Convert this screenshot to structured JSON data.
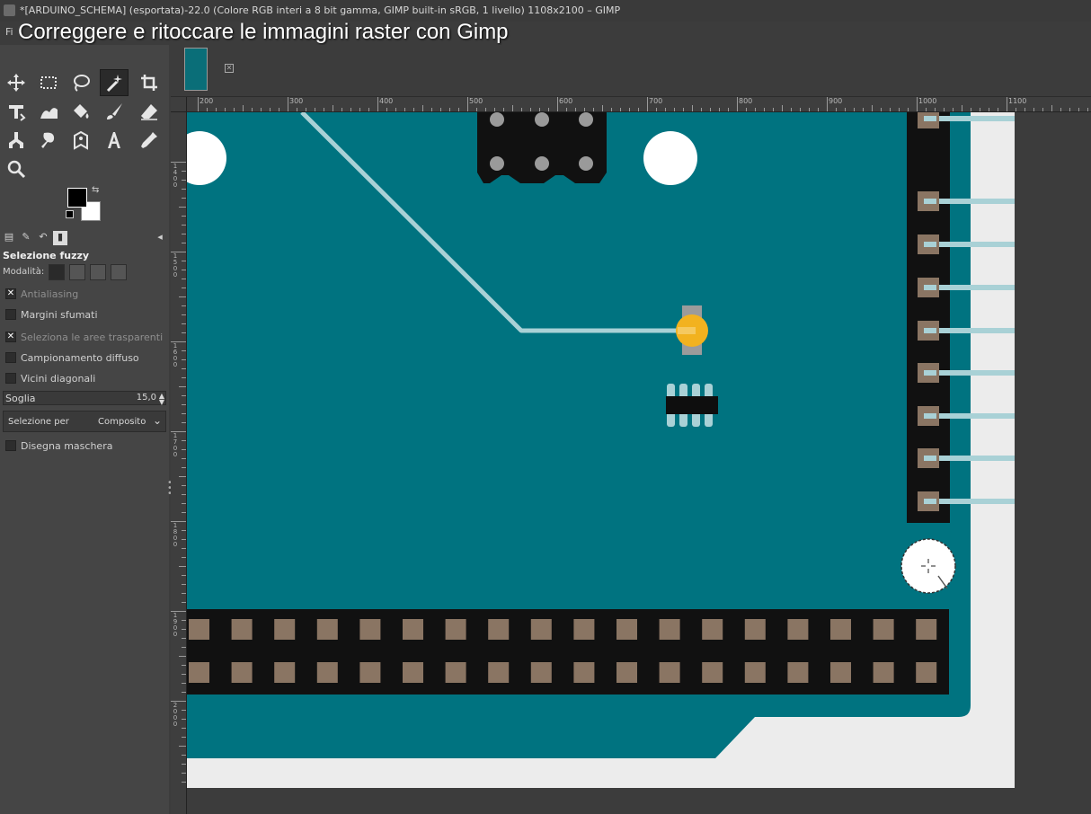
{
  "window": {
    "title": "*[ARDUINO_SCHEMA] (esportata)-22.0 (Colore RGB interi a 8 bit gamma, GIMP built-in sRGB, 1 livello) 1108x2100 – GIMP"
  },
  "menubar": {
    "first_item": "Fi"
  },
  "overlay": {
    "title": "Correggere e ritoccare le immagini raster con Gimp"
  },
  "tool_options": {
    "title": "Selezione fuzzy",
    "mode_label": "Modalità:",
    "options": [
      {
        "label": "Antialiasing",
        "checked": true
      },
      {
        "label": "Margini sfumati",
        "checked": false
      },
      {
        "label": "Seleziona le aree trasparenti",
        "checked": true
      },
      {
        "label": "Campionamento diffuso",
        "checked": false
      },
      {
        "label": "Vicini diagonali",
        "checked": false
      }
    ],
    "threshold": {
      "label": "Soglia",
      "value": "15,0"
    },
    "select_by": {
      "label": "Selezione per",
      "value": "Composito"
    },
    "draw_mask": {
      "label": "Disegna maschera",
      "checked": false
    }
  },
  "ruler": {
    "h_labels": [
      "200",
      "300",
      "400",
      "500",
      "600",
      "700",
      "800",
      "900",
      "1000",
      "1100"
    ],
    "v_labels": [
      "1400",
      "1500",
      "1600",
      "1700",
      "1800",
      "1900",
      "2000"
    ]
  },
  "colors": {
    "board": "#007380",
    "board_edge": "#ececec",
    "header": "#111111",
    "pad": "#8a7563",
    "trace": "#a9d1d6",
    "led": "#f2b21f",
    "chip": "#0e0e0e",
    "fg": "#000000",
    "bg": "#ffffff"
  }
}
